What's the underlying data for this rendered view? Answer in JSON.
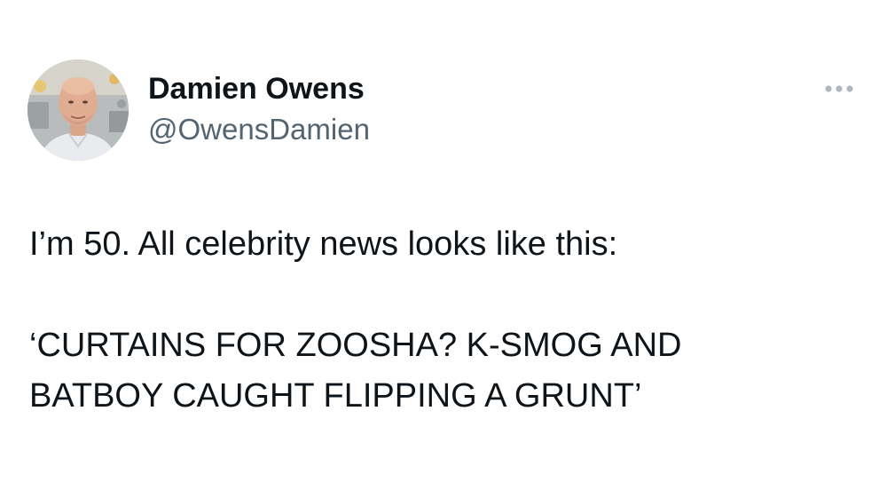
{
  "author": {
    "display_name": "Damien Owens",
    "handle": "@OwensDamien",
    "avatar_icon": "profile-photo"
  },
  "menu": {
    "more_icon": "more-horizontal-icon"
  },
  "tweet": {
    "line1": "I’m 50. All celebrity news looks like this:",
    "line2": "‘CURTAINS FOR ZOOSHA? K-SMOG AND\nBATBOY CAUGHT FLIPPING A GRUNT’"
  },
  "colors": {
    "text_primary": "#0f1419",
    "text_secondary": "#536471",
    "background": "#ffffff"
  }
}
